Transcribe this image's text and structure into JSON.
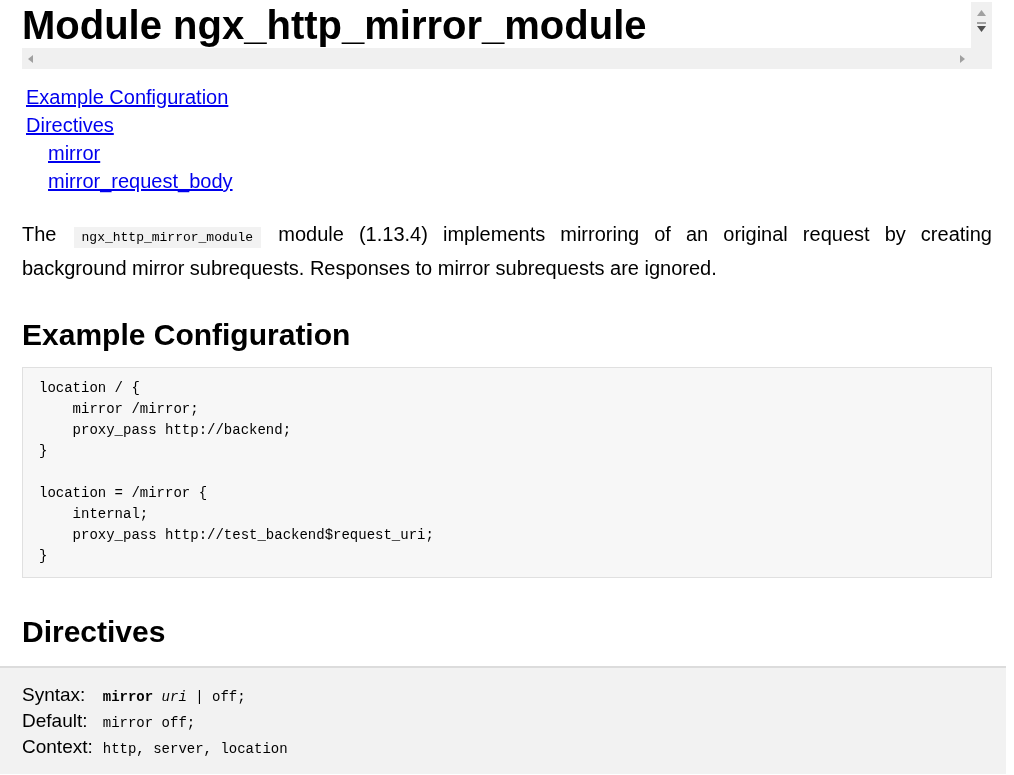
{
  "title": "Module ngx_http_mirror_module",
  "toc": [
    {
      "label": "Example Configuration"
    },
    {
      "label": "Directives",
      "children": [
        {
          "label": "mirror"
        },
        {
          "label": "mirror_request_body"
        }
      ]
    }
  ],
  "intro": {
    "before": "The",
    "code": "ngx_http_mirror_module",
    "after": "module (1.13.4) implements mirroring of an original request by creating background mirror subrequests. Responses to mirror subrequests are ignored."
  },
  "example": {
    "heading": "Example Configuration",
    "code": "location / {\n    mirror /mirror;\n    proxy_pass http://backend;\n}\n\nlocation = /mirror {\n    internal;\n    proxy_pass http://test_backend$request_uri;\n}"
  },
  "directives": {
    "heading": "Directives",
    "rows": [
      {
        "label": "Syntax:",
        "value": "**mirror** *uri* | off;"
      },
      {
        "label": "Default:",
        "value": "mirror off;"
      },
      {
        "label": "Context:",
        "value": "http, server, location"
      }
    ]
  }
}
